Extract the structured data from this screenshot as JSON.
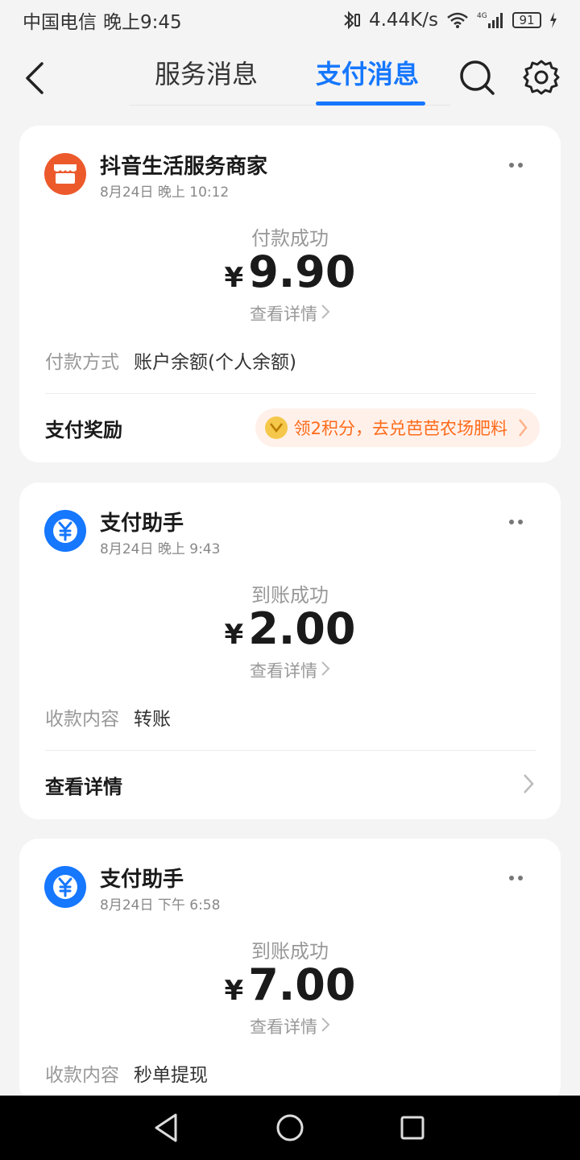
{
  "status_bar": {
    "carrier": "中国电信",
    "time": "晚上9:45",
    "speed": "4.44K/s",
    "network": "4G",
    "battery": "91"
  },
  "nav": {
    "back_icon": "chevron-left-icon",
    "tabs": [
      {
        "label": "服务消息",
        "active": false
      },
      {
        "label": "支付消息",
        "active": true
      }
    ],
    "search_icon": "search-icon",
    "settings_icon": "gear-icon",
    "accent_color": "#1677ff"
  },
  "cards": [
    {
      "name": "抖音生活服务商家",
      "time": "8月24日 晚上 10:12",
      "status": "付款成功",
      "currency": "¥",
      "amount": "9.90",
      "detail_link": "查看详情",
      "field_label": "付款方式",
      "field_value": "账户余额(个人余额)",
      "footer_label": "支付奖励",
      "reward_text": "领2积分，去兑芭芭农场肥料",
      "reward_coin_icon": "coin-icon"
    },
    {
      "name": "支付助手",
      "time": "8月24日 晚上 9:43",
      "status": "到账成功",
      "currency": "¥",
      "amount": "2.00",
      "detail_link": "查看详情",
      "field_label": "收款内容",
      "field_value": "转账",
      "footer_label": "查看详情"
    },
    {
      "name": "支付助手",
      "time": "8月24日 下午 6:58",
      "status": "到账成功",
      "currency": "¥",
      "amount": "7.00",
      "detail_link": "查看详情",
      "field_label": "收款内容",
      "field_value": "秒单提现"
    }
  ],
  "colors": {
    "merchant_avatar": "#ec5a2c",
    "assistant_avatar": "#1677ff",
    "reward_text": "#ff6a1a"
  }
}
